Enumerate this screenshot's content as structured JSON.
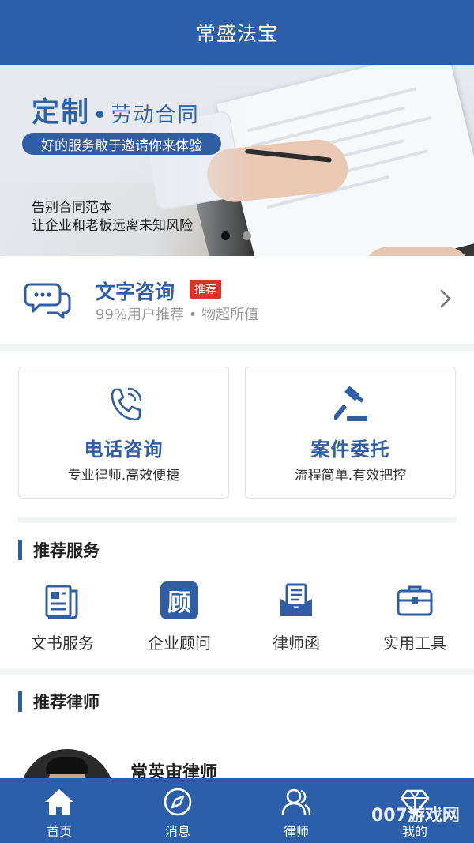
{
  "app": {
    "title": "常盛法宝"
  },
  "banner": {
    "title_main": "定制",
    "title_dot": "•",
    "title_sub": "劳动合同",
    "pill": "好的服务敢于邀请你来体验",
    "note_line1": "告别合同范本",
    "note_line2": "让企业和老板远离未知风险",
    "slide_count": 2,
    "active_slide": 1
  },
  "consult": {
    "icon": "chat-bubbles-icon",
    "title": "文字咨询",
    "badge": "推荐",
    "subtitle": "99%用户推荐 • 物超所值"
  },
  "cards": [
    {
      "icon": "phone-icon",
      "title": "电话咨询",
      "subtitle": "专业律师.高效便捷"
    },
    {
      "icon": "gavel-icon",
      "title": "案件委托",
      "subtitle": "流程简单.有效把控"
    }
  ],
  "services_section": {
    "title": "推荐服务"
  },
  "services": [
    {
      "icon": "document-icon",
      "label": "文书服务"
    },
    {
      "icon": "advisor-icon",
      "label": "企业顾问",
      "icon_text": "顾"
    },
    {
      "icon": "letter-icon",
      "label": "律师函"
    },
    {
      "icon": "toolbox-icon",
      "label": "实用工具"
    }
  ],
  "lawyers_section": {
    "title": "推荐律师"
  },
  "lawyer": {
    "name": "常英宙律师"
  },
  "tabbar": [
    {
      "icon": "home-icon",
      "label": "首页",
      "active": true
    },
    {
      "icon": "compass-icon",
      "label": "消息"
    },
    {
      "icon": "lawyer-icon",
      "label": "律师"
    },
    {
      "icon": "diamond-icon",
      "label": "我的"
    }
  ],
  "watermark": "007游戏网",
  "colors": {
    "primary": "#2b5faa",
    "accent_text": "#2f5ea6",
    "badge": "#d8352a",
    "divider": "#f3f4f6"
  }
}
